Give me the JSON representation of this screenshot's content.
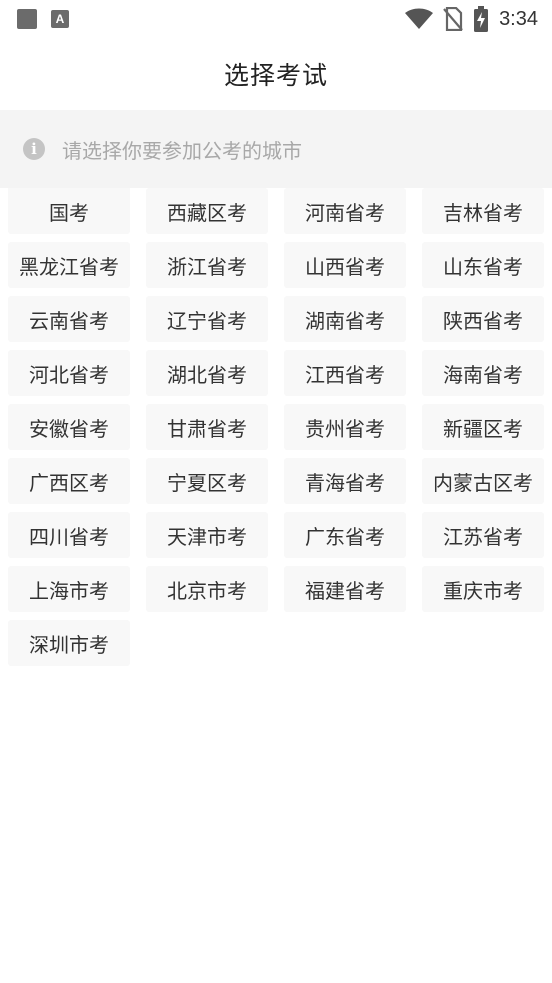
{
  "status_bar": {
    "time": "3:34",
    "icons": [
      "app-square-icon",
      "keyboard-a-icon",
      "wifi-icon",
      "no-sim-icon",
      "battery-charging-icon"
    ]
  },
  "header": {
    "title": "选择考试"
  },
  "hint": {
    "icon": "info-icon",
    "text": "请选择你要参加公考的城市"
  },
  "exams": [
    {
      "label": "国考"
    },
    {
      "label": "西藏区考"
    },
    {
      "label": "河南省考"
    },
    {
      "label": "吉林省考"
    },
    {
      "label": "黑龙江省考"
    },
    {
      "label": "浙江省考"
    },
    {
      "label": "山西省考"
    },
    {
      "label": "山东省考"
    },
    {
      "label": "云南省考"
    },
    {
      "label": "辽宁省考"
    },
    {
      "label": "湖南省考"
    },
    {
      "label": "陕西省考"
    },
    {
      "label": "河北省考"
    },
    {
      "label": "湖北省考"
    },
    {
      "label": "江西省考"
    },
    {
      "label": "海南省考"
    },
    {
      "label": "安徽省考"
    },
    {
      "label": "甘肃省考"
    },
    {
      "label": "贵州省考"
    },
    {
      "label": "新疆区考"
    },
    {
      "label": "广西区考"
    },
    {
      "label": "宁夏区考"
    },
    {
      "label": "青海省考"
    },
    {
      "label": "内蒙古区考"
    },
    {
      "label": "四川省考"
    },
    {
      "label": "天津市考"
    },
    {
      "label": "广东省考"
    },
    {
      "label": "江苏省考"
    },
    {
      "label": "上海市考"
    },
    {
      "label": "北京市考"
    },
    {
      "label": "福建省考"
    },
    {
      "label": "重庆市考"
    },
    {
      "label": "深圳市考"
    }
  ]
}
